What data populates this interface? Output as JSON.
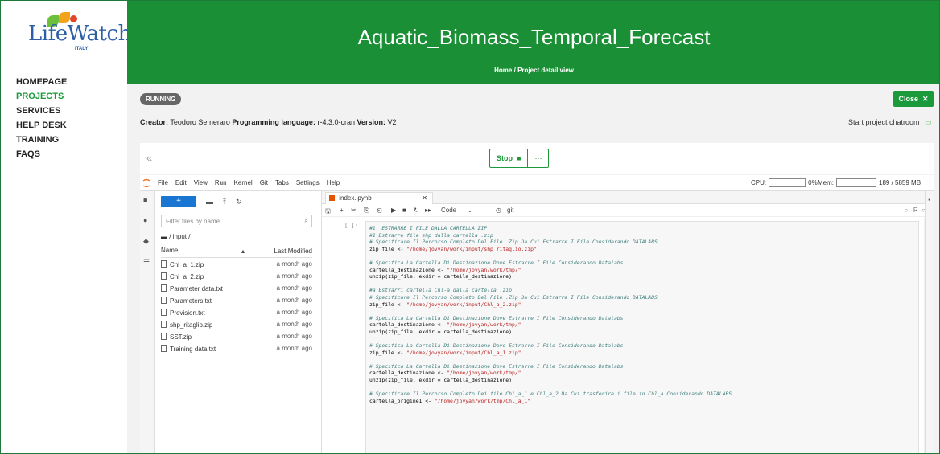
{
  "app": {
    "logo_text": "LifeWatch",
    "logo_sub": "ITALY"
  },
  "nav": {
    "items": [
      "HOMEPAGE",
      "PROJECTS",
      "SERVICES",
      "HELP DESK",
      "TRAINING",
      "FAQS"
    ],
    "active": "PROJECTS"
  },
  "header": {
    "title": "Aquatic_Biomass_Temporal_Forecast",
    "breadcrumb_home": "Home",
    "breadcrumb_sep": "/",
    "breadcrumb_current": "Project detail view"
  },
  "project": {
    "status": "RUNNING",
    "close_label": "Close",
    "creator_label": "Creator:",
    "creator": "Teodoro Semeraro",
    "language_label": "Programming language:",
    "language": "r-4.3.0-cran",
    "version_label": "Version:",
    "version": "V2",
    "chatroom_label": "Start project chatroom"
  },
  "controls": {
    "collapse_icon": "«",
    "stop_label": "Stop",
    "more_label": "···"
  },
  "jupyter": {
    "menu": [
      "File",
      "Edit",
      "View",
      "Run",
      "Kernel",
      "Git",
      "Tabs",
      "Settings",
      "Help"
    ],
    "cpu_label": "CPU:",
    "cpu_value": "0%",
    "mem_label": "Mem:",
    "mem_value": "189 / 5859 MB",
    "filter_placeholder": "Filter files by name",
    "path": "/ input /",
    "col_name": "Name",
    "col_modified": "Last Modified",
    "files": [
      {
        "name": "Chl_a_1.zip",
        "modified": "a month ago"
      },
      {
        "name": "Chl_a_2.zip",
        "modified": "a month ago"
      },
      {
        "name": "Parameter data.txt",
        "modified": "a month ago"
      },
      {
        "name": "Parameters.txt",
        "modified": "a month ago"
      },
      {
        "name": "Prevision.txt",
        "modified": "a month ago"
      },
      {
        "name": "shp_ritaglio.zip",
        "modified": "a month ago"
      },
      {
        "name": "SST.zip",
        "modified": "a month ago"
      },
      {
        "name": "Training data.txt",
        "modified": "a month ago"
      }
    ],
    "notebook_tab": "index.ipynb",
    "cell_type": "Code",
    "git_label": "git",
    "kernel_status": "R",
    "prompt": "[ ]:",
    "code_lines": [
      {
        "t": "c",
        "v": "#1. ESTRARRE I FILE DALLA CARTELLA ZIP"
      },
      {
        "t": "c",
        "v": "#1 Estrarre file shp dalla cartella .zip"
      },
      {
        "t": "c",
        "v": "# Specificare Il Percorso Completo Del File .Zip Da Cui Estrarre I File Considerando DATALABS"
      },
      {
        "t": "a",
        "v": "zip_file <- ",
        "s": "\"/home/jovyan/work/input/shp_ritaglio.zip\""
      },
      {
        "t": "b",
        "v": ""
      },
      {
        "t": "c",
        "v": "# Specifica La Cartella Di Destinazione Dove Estrarre I File Considerando Datalabs"
      },
      {
        "t": "a",
        "v": "cartella_destinazione <- ",
        "s": "\"/home/jovyan/work/tmp/\""
      },
      {
        "t": "p",
        "v": "unzip(zip_file, exdir = cartella_destinazione)"
      },
      {
        "t": "b",
        "v": ""
      },
      {
        "t": "c",
        "v": "#a Estrarri cartella Chl-a dalla cartella .zip"
      },
      {
        "t": "c",
        "v": "# Specificare Il Percorso Completo Del File .Zip Da Cui Estrarre I File Considerando DATALABS"
      },
      {
        "t": "a",
        "v": "zip_file <- ",
        "s": "\"/home/jovyan/work/input/Chl_a_2.zip\""
      },
      {
        "t": "b",
        "v": ""
      },
      {
        "t": "c",
        "v": "# Specifica La Cartella Di Destinazione Dove Estrarre I File Considerando Datalabs"
      },
      {
        "t": "a",
        "v": "cartella_destinazione <- ",
        "s": "\"/home/jovyan/work/tmp/\""
      },
      {
        "t": "p",
        "v": "unzip(zip_file, exdir = cartella_destinazione)"
      },
      {
        "t": "b",
        "v": ""
      },
      {
        "t": "c",
        "v": "# Specifica La Cartella Di Destinazione Dove Estrarre I File Considerando Datalabs"
      },
      {
        "t": "a",
        "v": "zip_file <- ",
        "s": "\"/home/jovyan/work/input/Chl_a_1.zip\""
      },
      {
        "t": "b",
        "v": ""
      },
      {
        "t": "c",
        "v": "# Specifica La Cartella Di Destinazione Dove Estrarre I File Considerando Datalabs"
      },
      {
        "t": "a",
        "v": "cartella_destinazione <- ",
        "s": "\"/home/jovyan/work/tmp/\""
      },
      {
        "t": "p",
        "v": "unzip(zip_file, exdir = cartella_destinazione)"
      },
      {
        "t": "b",
        "v": ""
      },
      {
        "t": "c",
        "v": "# Specificare Il Percorso Completo Dei file Chl_a_1 e Chl_a_2 Da Cui trasferire i file in Chl_a Considerando DATALABS"
      },
      {
        "t": "a",
        "v": "cartella_origine1 <- ",
        "s": "\"/home/jovyan/work/tmp/Chl_a_1\""
      }
    ]
  },
  "colors": {
    "brand_green": "#1a8f36",
    "accent_blue": "#1976d2",
    "running_badge": "#666666"
  }
}
